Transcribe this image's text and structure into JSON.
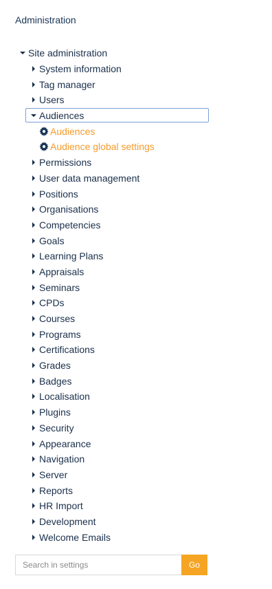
{
  "block": {
    "title": "Administration"
  },
  "tree": {
    "root_label": "Site administration",
    "items": [
      {
        "label": "System information"
      },
      {
        "label": "Tag manager"
      },
      {
        "label": "Users"
      },
      {
        "label": "Audiences",
        "children": [
          {
            "label": "Audiences",
            "icon": "gear-icon"
          },
          {
            "label": "Audience global settings",
            "icon": "gear-icon"
          }
        ]
      },
      {
        "label": "Permissions"
      },
      {
        "label": "User data management"
      },
      {
        "label": "Positions"
      },
      {
        "label": "Organisations"
      },
      {
        "label": "Competencies"
      },
      {
        "label": "Goals"
      },
      {
        "label": "Learning Plans"
      },
      {
        "label": "Appraisals"
      },
      {
        "label": "Seminars"
      },
      {
        "label": "CPDs"
      },
      {
        "label": "Courses"
      },
      {
        "label": "Programs"
      },
      {
        "label": "Certifications"
      },
      {
        "label": "Grades"
      },
      {
        "label": "Badges"
      },
      {
        "label": "Localisation"
      },
      {
        "label": "Plugins"
      },
      {
        "label": "Security"
      },
      {
        "label": "Appearance"
      },
      {
        "label": "Navigation"
      },
      {
        "label": "Server"
      },
      {
        "label": "Reports"
      },
      {
        "label": "HR Import"
      },
      {
        "label": "Development"
      },
      {
        "label": "Welcome Emails"
      }
    ]
  },
  "search": {
    "placeholder": "Search in settings",
    "value": "",
    "button_label": "Go"
  },
  "colors": {
    "text": "#1a2f4b",
    "link": "#f59b2b",
    "focus_border": "#7a9fd8",
    "go_button": "#f5a523"
  }
}
